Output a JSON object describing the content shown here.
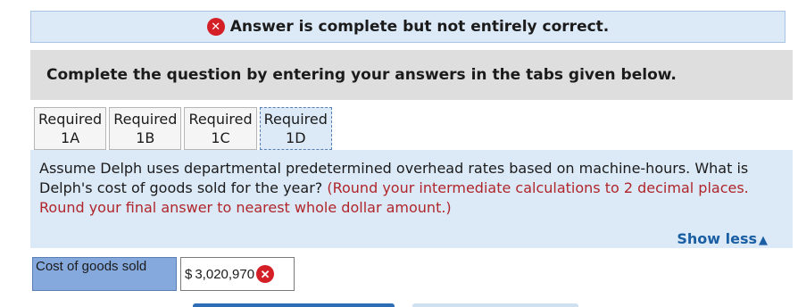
{
  "banner": {
    "icon": "error-x-icon",
    "text": "Answer is complete but not entirely correct."
  },
  "instruction": "Complete the question by entering your answers in the tabs given below.",
  "tabs": [
    {
      "line1": "Required",
      "line2": "1A",
      "active": false
    },
    {
      "line1": "Required",
      "line2": "1B",
      "active": false
    },
    {
      "line1": "Required",
      "line2": "1C",
      "active": false
    },
    {
      "line1": "Required",
      "line2": "1D",
      "active": true
    }
  ],
  "question": {
    "text": "Assume Delph uses departmental predetermined overhead rates based on machine-hours. What is Delph's cost of goods sold for the year?",
    "hint": "(Round your intermediate calculations to 2 decimal places. Round your final answer to nearest whole dollar amount.)"
  },
  "show_less_label": "Show less",
  "answer": {
    "label": "Cost of goods sold",
    "currency": "$",
    "value": "3,020,970",
    "status_icon": "error-x-icon"
  },
  "colors": {
    "banner_bg": "#dce9f7",
    "error_red": "#d41f26",
    "hint_red": "#b0262b",
    "link_blue": "#1a5fa3",
    "label_bg": "#85a9dc"
  }
}
